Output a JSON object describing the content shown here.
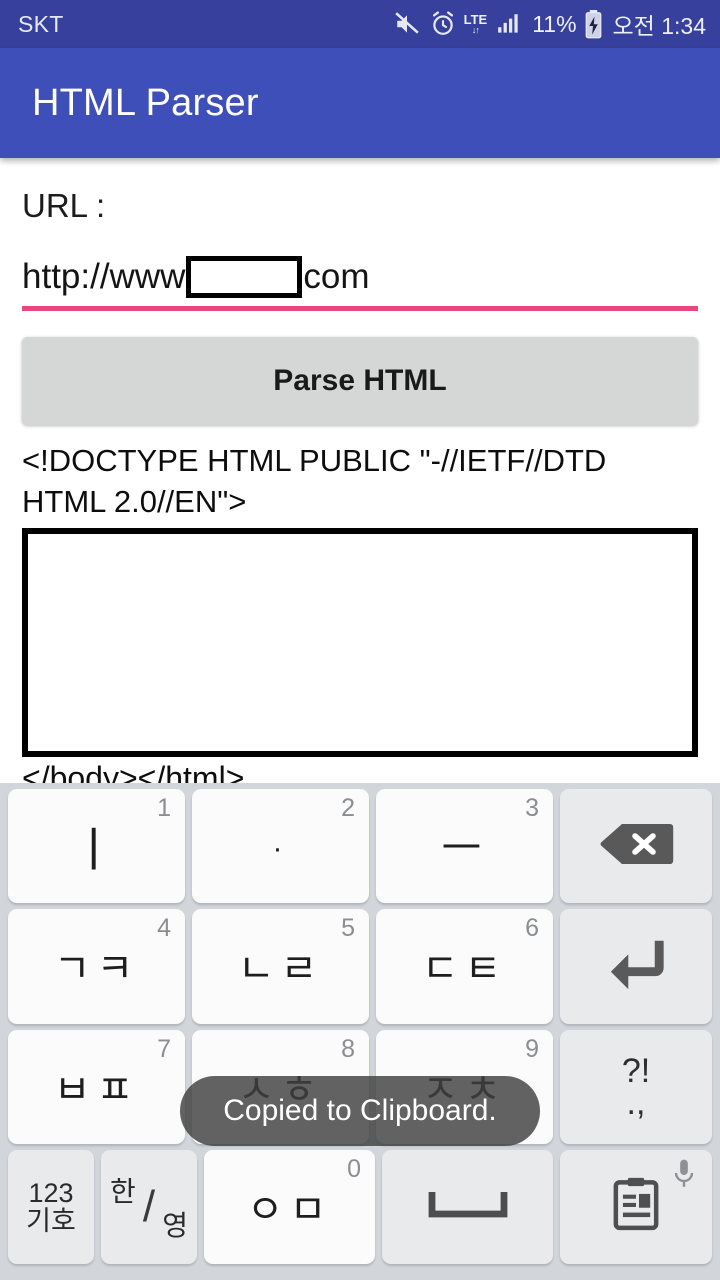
{
  "status_bar": {
    "carrier": "SKT",
    "network": "LTE",
    "battery_percent": "11%",
    "clock": "오전 1:34",
    "icons": [
      "mute-icon",
      "alarm-icon",
      "lte-icon",
      "signal-icon",
      "battery-charging-icon"
    ]
  },
  "app_bar": {
    "title": "HTML Parser"
  },
  "main": {
    "url_label": "URL :",
    "url_value_prefix": "http://www",
    "url_value_suffix": "com",
    "parse_button_label": "Parse HTML",
    "doctype_text": "<!DOCTYPE HTML PUBLIC \"-//IETF//DTD HTML 2.0//EN\">",
    "closing_tags_text": "</body></html>"
  },
  "toast": {
    "message": "Copied to Clipboard."
  },
  "keyboard": {
    "type": "korean-cheonjiin-12key",
    "rows": [
      [
        {
          "name": "key-i",
          "num": "1",
          "glyph": "ㅣ"
        },
        {
          "name": "key-dot",
          "num": "2",
          "glyph": "·"
        },
        {
          "name": "key-eu",
          "num": "3",
          "glyph": "ㅡ"
        },
        {
          "name": "key-backspace",
          "num": "",
          "glyph": "backspace-icon"
        }
      ],
      [
        {
          "name": "key-giyeok-kieuk",
          "num": "4",
          "glyph": "ㄱㅋ"
        },
        {
          "name": "key-nieun-rieul",
          "num": "5",
          "glyph": "ㄴㄹ"
        },
        {
          "name": "key-digeut-tieut",
          "num": "6",
          "glyph": "ㄷㅌ"
        },
        {
          "name": "key-enter",
          "num": "",
          "glyph": "enter-icon"
        }
      ],
      [
        {
          "name": "key-bieup-pieup",
          "num": "7",
          "glyph": "ㅂㅍ"
        },
        {
          "name": "key-siot-hieut",
          "num": "8",
          "glyph": "ㅅㅎ"
        },
        {
          "name": "key-jieut-chieut",
          "num": "9",
          "glyph": "ㅈㅊ"
        },
        {
          "name": "key-punctuation",
          "num": "",
          "glyph": "?!",
          "glyph2": ".,"
        }
      ],
      [
        {
          "name": "key-numbers-symbols",
          "line1": "123",
          "line2": "기호"
        },
        {
          "name": "key-korean-english",
          "line1": "한",
          "line2": "영"
        },
        {
          "name": "key-ieung-mieum",
          "num": "0",
          "glyph": "ㅇㅁ"
        },
        {
          "name": "key-space",
          "glyph": "space-icon"
        },
        {
          "name": "key-clipboard",
          "glyph": "clipboard-icon",
          "sub": "mic-icon"
        }
      ]
    ]
  },
  "colors": {
    "status_bar": "#37409c",
    "app_bar": "#3f4fba",
    "underline_accent": "#e8467c",
    "button": "#d5d6d6",
    "keyboard_bg": "#d2d6db"
  }
}
